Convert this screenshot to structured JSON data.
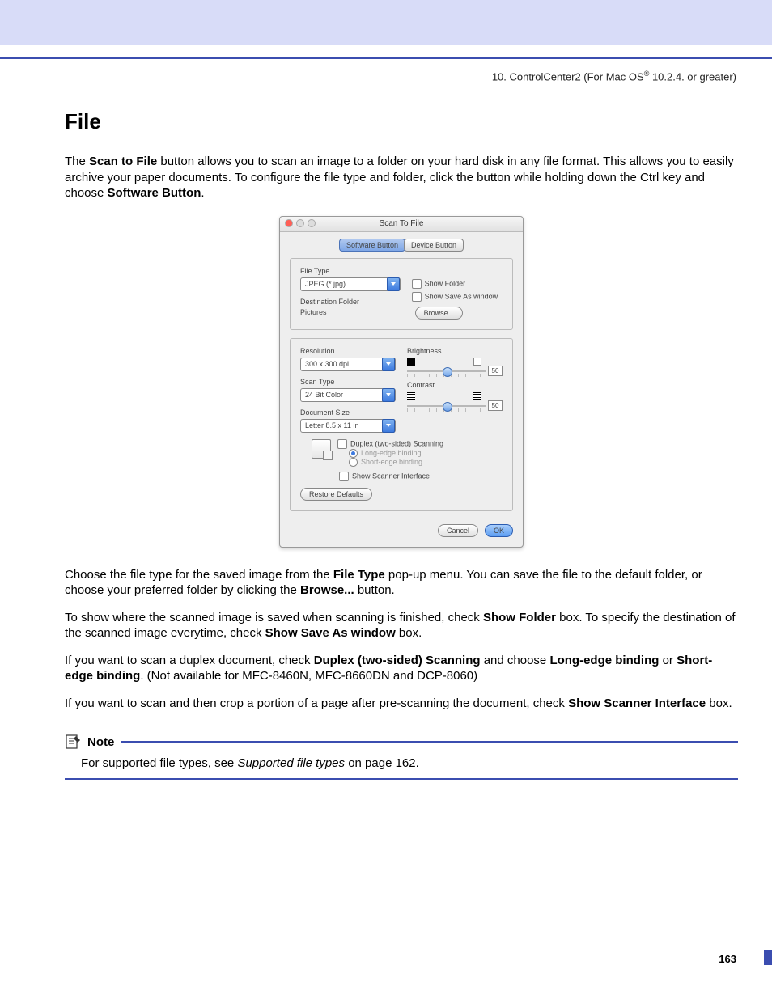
{
  "header": {
    "chapter_prefix": "10. ControlCenter2 (For Mac OS",
    "reg": "®",
    "chapter_suffix": " 10.2.4. or greater)"
  },
  "title": "File",
  "intro": {
    "a": "The ",
    "b": "Scan to File",
    "c": " button allows you to scan an image to a folder on your hard disk in any file format. This allows you to easily archive your paper documents. To configure the file type and folder, click the button while holding down the Ctrl key and choose ",
    "d": "Software Button",
    "e": "."
  },
  "dialog": {
    "title": "Scan To File",
    "tabs": {
      "software": "Software Button",
      "device": "Device Button"
    },
    "labels": {
      "file_type": "File Type",
      "dest_folder": "Destination Folder",
      "resolution": "Resolution",
      "scan_type": "Scan Type",
      "doc_size": "Document Size",
      "brightness": "Brightness",
      "contrast": "Contrast"
    },
    "values": {
      "file_type": "JPEG (*.jpg)",
      "dest_folder": "Pictures",
      "resolution": "300 x 300 dpi",
      "scan_type": "24 Bit Color",
      "doc_size": "Letter  8.5 x 11 in",
      "brightness": "50",
      "contrast": "50"
    },
    "checks": {
      "show_folder": "Show Folder",
      "show_save_as": "Show Save As window",
      "duplex": "Duplex (two-sided) Scanning",
      "long_edge": "Long-edge binding",
      "short_edge": "Short-edge binding",
      "show_scanner": "Show Scanner Interface"
    },
    "buttons": {
      "browse": "Browse...",
      "restore": "Restore Defaults",
      "cancel": "Cancel",
      "ok": "OK"
    }
  },
  "p2": {
    "a": "Choose the file type for the saved image from the ",
    "b": "File Type",
    "c": " pop-up menu. You can save the file to the default folder, or choose your preferred folder by clicking the ",
    "d": "Browse...",
    "e": " button."
  },
  "p3": {
    "a": "To show where the scanned image is saved when scanning is finished, check ",
    "b": "Show Folder",
    "c": " box. To specify the destination of the scanned image everytime, check ",
    "d": "Show Save As window",
    "e": " box."
  },
  "p4": {
    "a": "If you want to scan a duplex document, check ",
    "b": "Duplex (two-sided) Scanning",
    "c": " and choose ",
    "d": "Long-edge binding",
    "e": " or ",
    "f": "Short-edge binding",
    "g": ". (Not available for MFC-8460N, MFC-8660DN and DCP-8060)"
  },
  "p5": {
    "a": "If you want to scan and then crop a portion of a page after pre-scanning the document, check ",
    "b": "Show Scanner Interface",
    "c": " box."
  },
  "note": {
    "title": "Note",
    "a": "For supported file types, see ",
    "b": "Supported file types",
    "c": " on page 162."
  },
  "page_number": "163"
}
